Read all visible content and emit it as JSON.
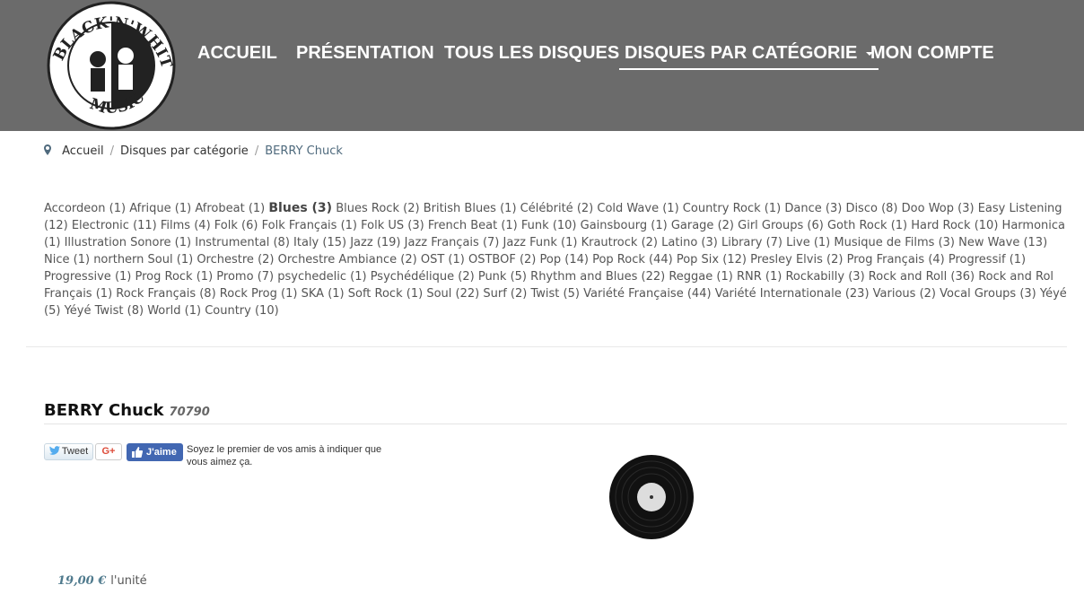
{
  "logo": {
    "text_top": "BLACK'N'WHITE",
    "text_bottom": "MUSIC"
  },
  "nav": {
    "items": [
      {
        "label": "ACCUEIL"
      },
      {
        "label": "PRÉSENTATION"
      },
      {
        "label": "TOUS LES DISQUES"
      },
      {
        "label": "DISQUES PAR CATÉGORIE"
      },
      {
        "label": "MON COMPTE"
      }
    ]
  },
  "breadcrumb": {
    "items": [
      "Accueil",
      "Disques par catégorie"
    ],
    "current": "BERRY Chuck"
  },
  "categories": [
    {
      "name": "Accordeon",
      "count": "(1)"
    },
    {
      "name": "Afrique",
      "count": "(1)"
    },
    {
      "name": "Afrobeat",
      "count": "(1)"
    },
    {
      "name": "Blues",
      "count": "(3)",
      "active": true
    },
    {
      "name": "Blues Rock",
      "count": "(2)"
    },
    {
      "name": "British Blues",
      "count": "(1)"
    },
    {
      "name": "Célébrité",
      "count": "(2)"
    },
    {
      "name": "Cold Wave",
      "count": "(1)"
    },
    {
      "name": "Country Rock",
      "count": "(1)"
    },
    {
      "name": "Dance",
      "count": "(3)"
    },
    {
      "name": "Disco",
      "count": "(8)"
    },
    {
      "name": "Doo Wop",
      "count": "(3)"
    },
    {
      "name": "Easy Listening",
      "count": "(12)"
    },
    {
      "name": "Electronic",
      "count": "(11)"
    },
    {
      "name": "Films",
      "count": "(4)"
    },
    {
      "name": "Folk",
      "count": "(6)"
    },
    {
      "name": "Folk Français",
      "count": "(1)"
    },
    {
      "name": "Folk US",
      "count": "(3)"
    },
    {
      "name": "French Beat",
      "count": "(1)"
    },
    {
      "name": "Funk",
      "count": "(10)"
    },
    {
      "name": "Gainsbourg",
      "count": "(1)"
    },
    {
      "name": "Garage",
      "count": "(2)"
    },
    {
      "name": "Girl Groups",
      "count": "(6)"
    },
    {
      "name": "Goth Rock",
      "count": "(1)"
    },
    {
      "name": "Hard Rock",
      "count": "(10)"
    },
    {
      "name": "Harmonica",
      "count": "(1)"
    },
    {
      "name": "Illustration Sonore",
      "count": "(1)"
    },
    {
      "name": "Instrumental",
      "count": "(8)"
    },
    {
      "name": "Italy",
      "count": "(15)"
    },
    {
      "name": "Jazz",
      "count": "(19)"
    },
    {
      "name": "Jazz Français",
      "count": "(7)"
    },
    {
      "name": "Jazz Funk",
      "count": "(1)"
    },
    {
      "name": "Krautrock",
      "count": "(2)"
    },
    {
      "name": "Latino",
      "count": "(3)"
    },
    {
      "name": "Library",
      "count": "(7)"
    },
    {
      "name": "Live",
      "count": "(1)"
    },
    {
      "name": "Musique de Films",
      "count": "(3)"
    },
    {
      "name": "New Wave",
      "count": "(13)"
    },
    {
      "name": "Nice",
      "count": "(1)"
    },
    {
      "name": "northern Soul",
      "count": "(1)"
    },
    {
      "name": "Orchestre",
      "count": "(2)"
    },
    {
      "name": "Orchestre Ambiance",
      "count": "(2)"
    },
    {
      "name": "OST",
      "count": "(1)"
    },
    {
      "name": "OSTBOF",
      "count": "(2)"
    },
    {
      "name": "Pop",
      "count": "(14)"
    },
    {
      "name": "Pop Rock",
      "count": "(44)"
    },
    {
      "name": "Pop Six",
      "count": "(12)"
    },
    {
      "name": "Presley Elvis",
      "count": "(2)"
    },
    {
      "name": "Prog Français",
      "count": "(4)"
    },
    {
      "name": "Progressif",
      "count": "(1)"
    },
    {
      "name": "Progressive",
      "count": "(1)"
    },
    {
      "name": "Prog Rock",
      "count": "(1)"
    },
    {
      "name": "Promo",
      "count": "(7)"
    },
    {
      "name": "psychedelic",
      "count": "(1)"
    },
    {
      "name": "Psychédélique",
      "count": "(2)"
    },
    {
      "name": "Punk",
      "count": "(5)"
    },
    {
      "name": "Rhythm and Blues",
      "count": "(22)"
    },
    {
      "name": "Reggae",
      "count": "(1)"
    },
    {
      "name": "RNR",
      "count": "(1)"
    },
    {
      "name": "Rockabilly",
      "count": "(3)"
    },
    {
      "name": "Rock and Roll",
      "count": "(36)"
    },
    {
      "name": "Rock and Rol Français",
      "count": "(1)"
    },
    {
      "name": "Rock Français",
      "count": "(8)"
    },
    {
      "name": "Rock Prog",
      "count": "(1)"
    },
    {
      "name": "SKA",
      "count": "(1)"
    },
    {
      "name": "Soft Rock",
      "count": "(1)"
    },
    {
      "name": "Soul",
      "count": "(22)"
    },
    {
      "name": "Surf",
      "count": "(2)"
    },
    {
      "name": "Twist",
      "count": "(5)"
    },
    {
      "name": "Variété Française",
      "count": "(44)"
    },
    {
      "name": "Variété Internationale",
      "count": "(23)"
    },
    {
      "name": "Various",
      "count": "(2)"
    },
    {
      "name": "Vocal Groups",
      "count": "(3)"
    },
    {
      "name": "Yéyé",
      "count": "(5)"
    },
    {
      "name": "Yéyé Twist",
      "count": "(8)"
    },
    {
      "name": "World",
      "count": "(1)"
    },
    {
      "name": "Country",
      "count": "(10)"
    }
  ],
  "product": {
    "title": "BERRY Chuck",
    "ref": "70790",
    "price": "19,00 €",
    "unit": "l'unité"
  },
  "social": {
    "tweet": "Tweet",
    "gplus": "G+",
    "like": "J'aime",
    "like_text": "Soyez le premier de vos amis à indiquer que vous aimez ça."
  }
}
